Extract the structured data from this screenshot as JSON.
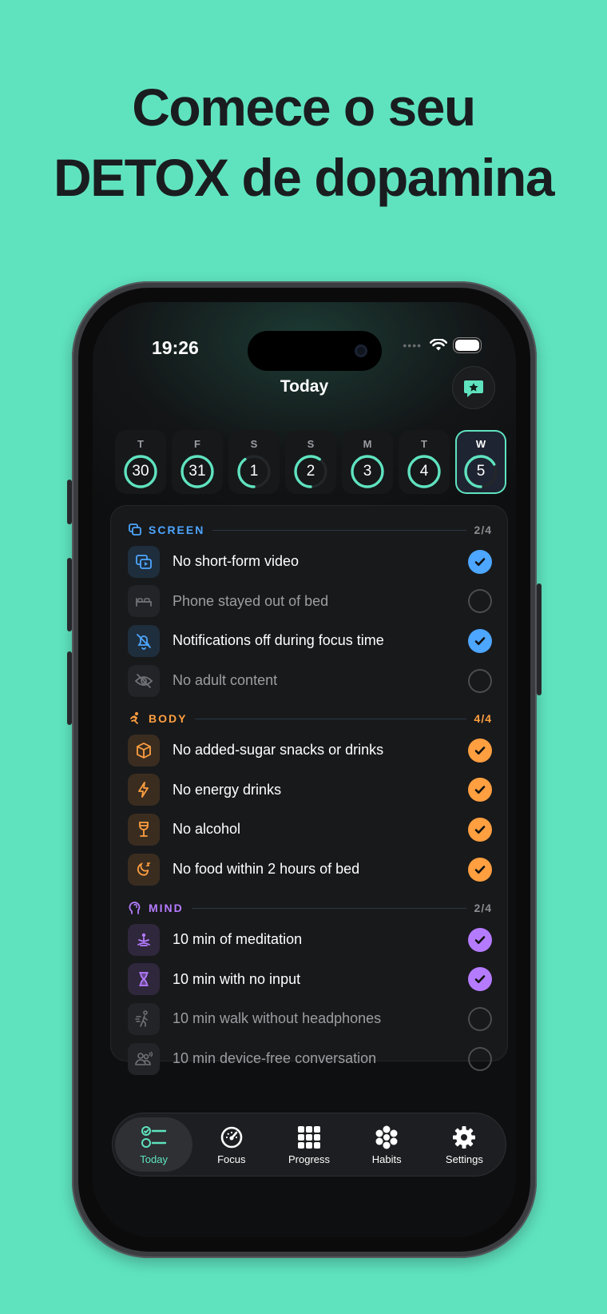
{
  "headline": {
    "line1": "Comece o seu",
    "line2": "DETOX de dopamina"
  },
  "status_bar": {
    "time": "19:26",
    "wifi_icon": "wifi-icon",
    "battery_icon": "battery-icon"
  },
  "header": {
    "title": "Today",
    "action_icon": "chat-star-icon"
  },
  "days": [
    {
      "letter": "T",
      "number": "30",
      "progress": 1.0
    },
    {
      "letter": "F",
      "number": "31",
      "progress": 1.0
    },
    {
      "letter": "S",
      "number": "1",
      "progress": 0.4
    },
    {
      "letter": "S",
      "number": "2",
      "progress": 0.6
    },
    {
      "letter": "M",
      "number": "3",
      "progress": 1.0
    },
    {
      "letter": "T",
      "number": "4",
      "progress": 1.0
    },
    {
      "letter": "W",
      "number": "5",
      "progress": 0.67,
      "active": true
    }
  ],
  "sections": [
    {
      "label": "SCREEN",
      "count": "2/4",
      "color": "#4da6ff",
      "icon": "screens-icon",
      "items": [
        {
          "label": "No short-form video",
          "done": true,
          "icon": "video-icon"
        },
        {
          "label": "Phone stayed out of bed",
          "done": false,
          "icon": "bed-icon"
        },
        {
          "label": "Notifications off during focus time",
          "done": true,
          "icon": "bell-off-icon"
        },
        {
          "label": "No adult content",
          "done": false,
          "icon": "eye-off-icon"
        }
      ]
    },
    {
      "label": "BODY",
      "count": "4/4",
      "color": "#ff9f40",
      "icon": "running-icon",
      "items": [
        {
          "label": "No added-sugar snacks or drinks",
          "done": true,
          "icon": "cube-icon"
        },
        {
          "label": "No energy drinks",
          "done": true,
          "icon": "bolt-icon"
        },
        {
          "label": "No alcohol",
          "done": true,
          "icon": "wine-glass-icon"
        },
        {
          "label": "No food within 2 hours of bed",
          "done": true,
          "icon": "moon-sleep-icon"
        }
      ]
    },
    {
      "label": "MIND",
      "count": "2/4",
      "color": "#b57bff",
      "icon": "head-icon",
      "items": [
        {
          "label": "10 min of meditation",
          "done": true,
          "icon": "meditation-icon"
        },
        {
          "label": "10 min with no input",
          "done": true,
          "icon": "hourglass-icon"
        },
        {
          "label": "10 min walk without headphones",
          "done": false,
          "icon": "walking-icon"
        },
        {
          "label": "10 min device-free conversation",
          "done": false,
          "icon": "conversation-icon"
        }
      ]
    }
  ],
  "tabs": [
    {
      "label": "Today",
      "icon": "checklist-icon",
      "active": true
    },
    {
      "label": "Focus",
      "icon": "gauge-icon"
    },
    {
      "label": "Progress",
      "icon": "grid-icon"
    },
    {
      "label": "Habits",
      "icon": "flower-icon"
    },
    {
      "label": "Settings",
      "icon": "gear-icon"
    }
  ],
  "colors": {
    "background": "#5fe3bf",
    "accent": "#5fe3bf",
    "screen": "#4da6ff",
    "body": "#ff9f40",
    "mind": "#b57bff"
  }
}
